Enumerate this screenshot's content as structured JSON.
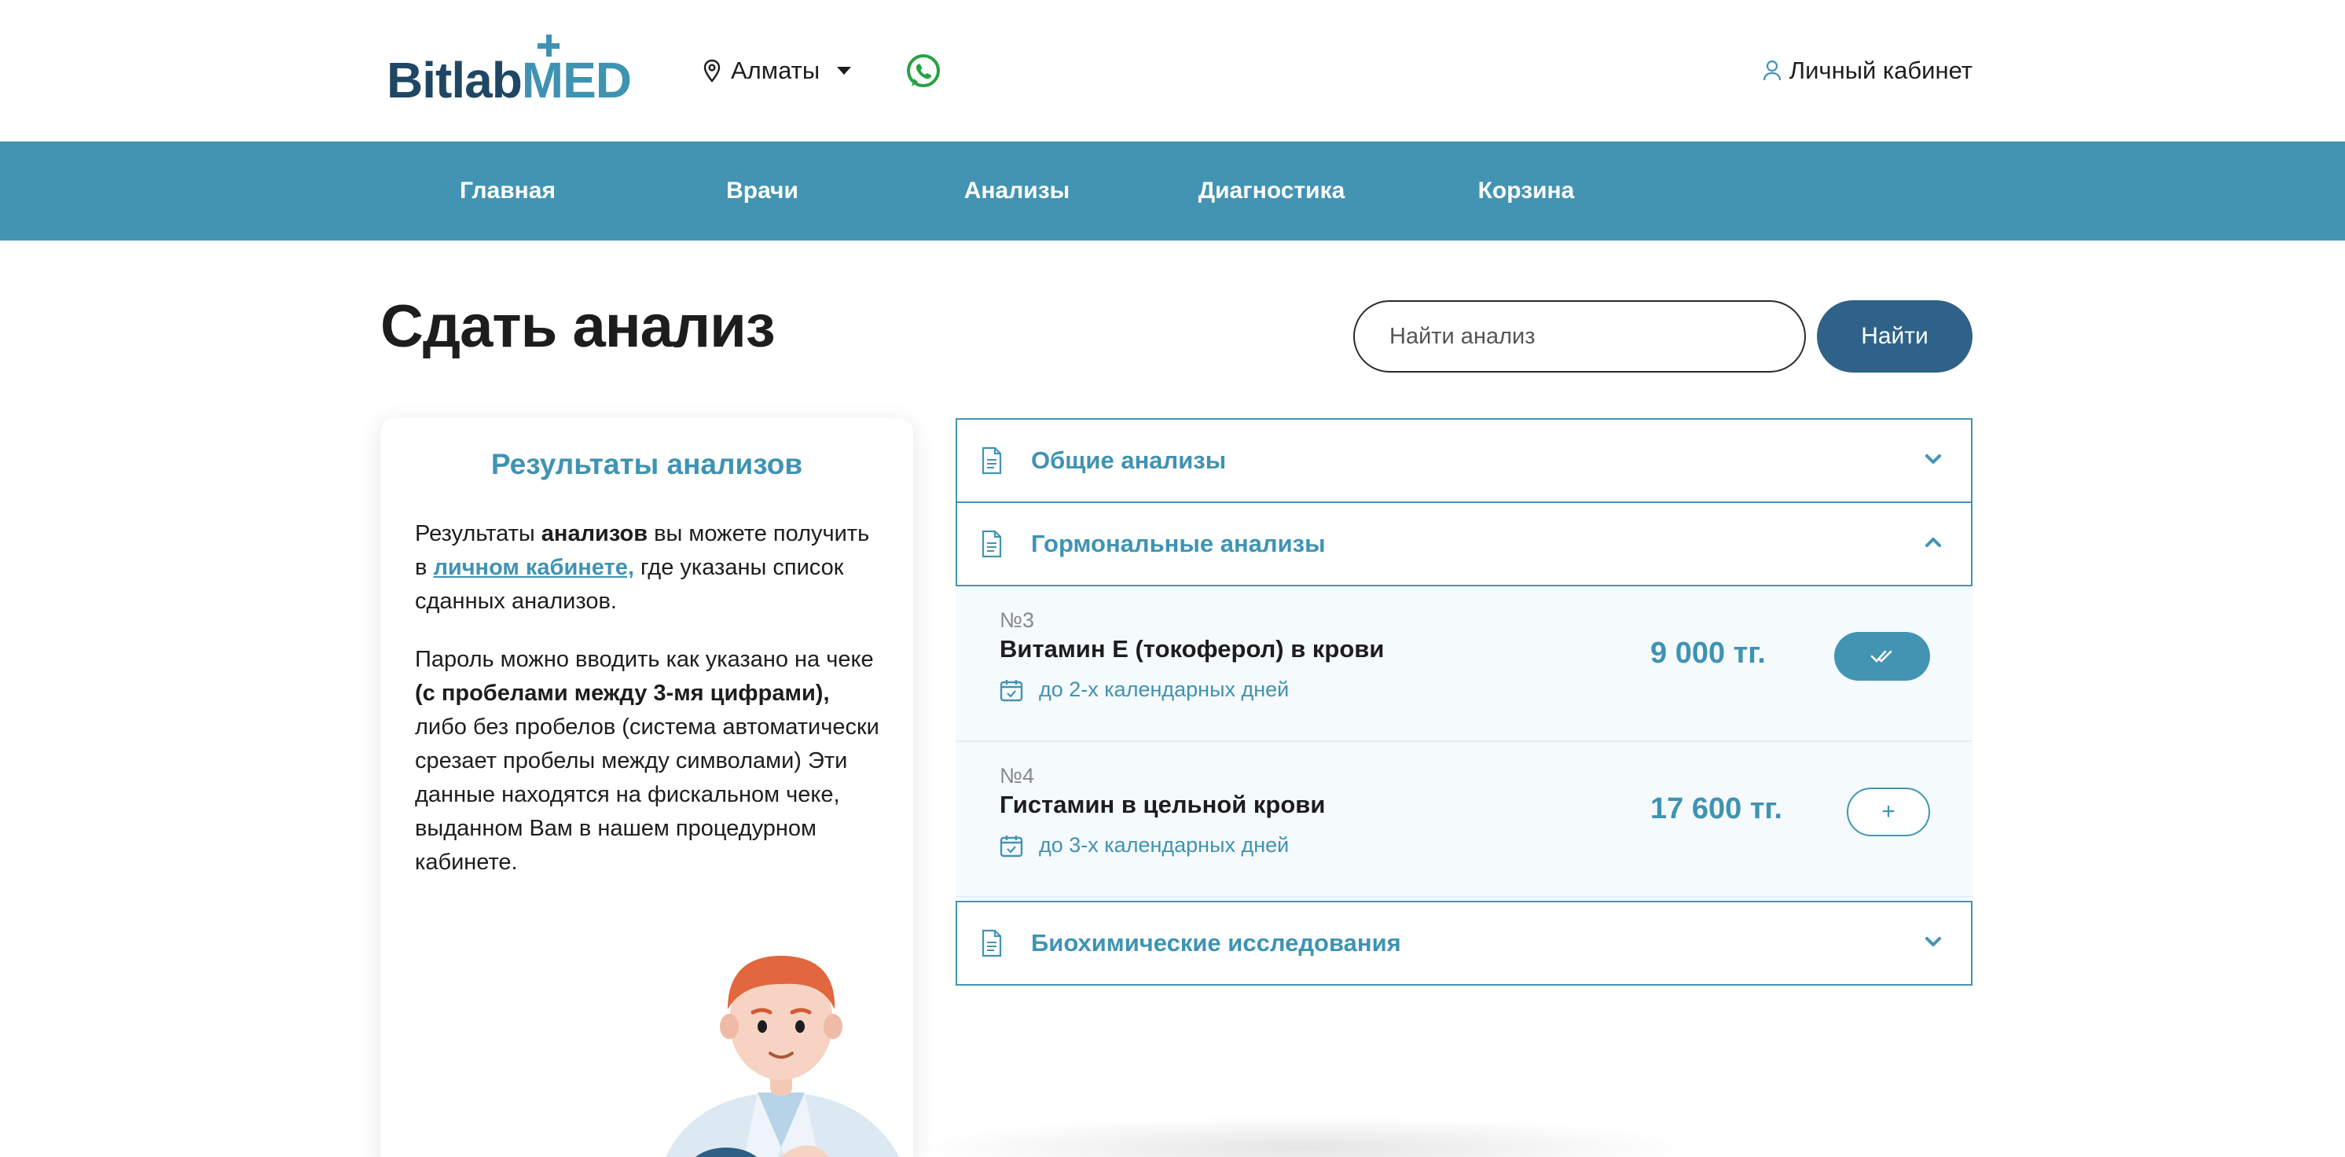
{
  "header": {
    "logo": {
      "part1": "Bitlab",
      "part2": "MED"
    },
    "city": "Алматы",
    "account_label": "Личный кабинет"
  },
  "nav": {
    "items": [
      {
        "label": "Главная"
      },
      {
        "label": "Врачи"
      },
      {
        "label": "Анализы"
      },
      {
        "label": "Диагностика"
      },
      {
        "label": "Корзина"
      }
    ]
  },
  "main": {
    "title": "Сдать анализ",
    "search": {
      "placeholder": "Найти анализ",
      "button_label": "Найти"
    }
  },
  "results_card": {
    "title": "Результаты анализов",
    "p1": {
      "t1": "Результаты ",
      "b1": "анализов",
      "t2": " вы можете получить в ",
      "link": "личном кабинете,",
      "t3": " где указаны список сданных анализов."
    },
    "p2": {
      "t1": "Пароль можно вводить как указано на чеке ",
      "b1": "(с пробелами между 3-мя цифрами),",
      "t2": " либо без пробелов (система автоматически срезает пробелы между символами) Эти данные находятся на фискальном чеке, выданном Вам в нашем процедурном кабинете."
    }
  },
  "accordion": {
    "sections": [
      {
        "label": "Общие анализы",
        "expanded": false
      },
      {
        "label": "Гормональные анализы",
        "expanded": true
      },
      {
        "label": "Биохимические исследования",
        "expanded": false
      }
    ],
    "tests": [
      {
        "number": "№3",
        "name": "Витамин Е (токоферол) в крови",
        "term": "до 2-х календарных дней",
        "price": "9 000 тг.",
        "in_cart": true
      },
      {
        "number": "№4",
        "name": "Гистамин в цельной крови",
        "term": "до 3-х календарных дней",
        "price": "17 600 тг.",
        "in_cart": false,
        "add_label": "+"
      }
    ]
  },
  "colors": {
    "accent": "#4294b2",
    "nav_bg": "#4294b2",
    "button_dark": "#2e6288",
    "logo_dark": "#1f4764",
    "whatsapp": "#25a244"
  },
  "icons": [
    "location-pin-icon",
    "caret-down-icon",
    "whatsapp-icon",
    "user-icon",
    "document-icon",
    "chevron-down-icon",
    "chevron-up-icon",
    "calendar-check-icon",
    "double-check-icon",
    "plus-icon"
  ]
}
